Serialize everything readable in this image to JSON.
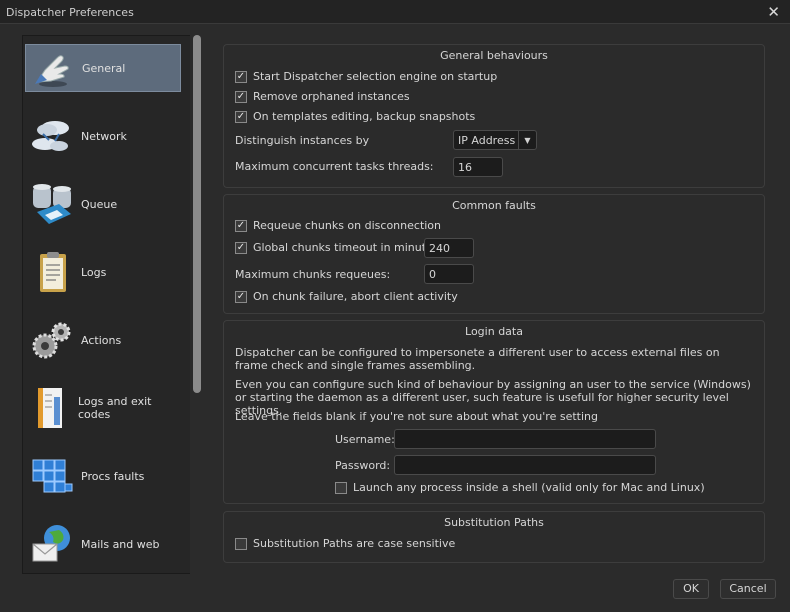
{
  "window": {
    "title": "Dispatcher Preferences",
    "close_glyph": "✕"
  },
  "sidebar": {
    "items": [
      {
        "label": "General",
        "icon": "pointing-hand-icon"
      },
      {
        "label": "Network",
        "icon": "cloud-network-icon"
      },
      {
        "label": "Queue",
        "icon": "database-queue-icon"
      },
      {
        "label": "Logs",
        "icon": "clipboard-icon"
      },
      {
        "label": "Actions",
        "icon": "gears-icon"
      },
      {
        "label": "Logs and exit codes",
        "icon": "notebook-icon"
      },
      {
        "label": "Procs faults",
        "icon": "blue-cubes-icon"
      },
      {
        "label": "Mails and web",
        "icon": "mail-globe-icon"
      }
    ]
  },
  "general_behaviours": {
    "title": "General behaviours",
    "start_engine": "Start Dispatcher selection engine on startup",
    "remove_orphaned": "Remove orphaned instances",
    "backup_snapshots": "On templates editing, backup snapshots",
    "distinguish_label": "Distinguish instances by",
    "distinguish_value": "IP Address",
    "max_threads_label": "Maximum concurrent tasks threads:",
    "max_threads_value": "16"
  },
  "common_faults": {
    "title": "Common faults",
    "requeue": "Requeue chunks on disconnection",
    "global_timeout": "Global chunks timeout in minutes:",
    "global_timeout_value": "240",
    "max_requeues_label": "Maximum chunks requeues:",
    "max_requeues_value": "0",
    "abort_client": "On chunk failure, abort client activity"
  },
  "login_data": {
    "title": "Login data",
    "para1": "Dispatcher can be configured to impersonete a different user to access external files on frame check and single frames assembling.",
    "para2": "Even you can configure such kind of behaviour by assigning an user to the service (Windows) or starting the daemon as a different user, such feature is usefull for higher security level settings.",
    "para3": "Leave the fields blank if you're not sure about what you're setting",
    "username_label": "Username:",
    "username_value": "",
    "password_label": "Password:",
    "password_value": "",
    "launch_shell": "Launch any process inside a shell (valid only for Mac and Linux)"
  },
  "substitution_paths": {
    "title": "Substitution Paths",
    "case_sensitive": "Substitution Paths are case sensitive"
  },
  "buttons": {
    "ok": "OK",
    "cancel": "Cancel"
  },
  "check_glyph": "✓"
}
